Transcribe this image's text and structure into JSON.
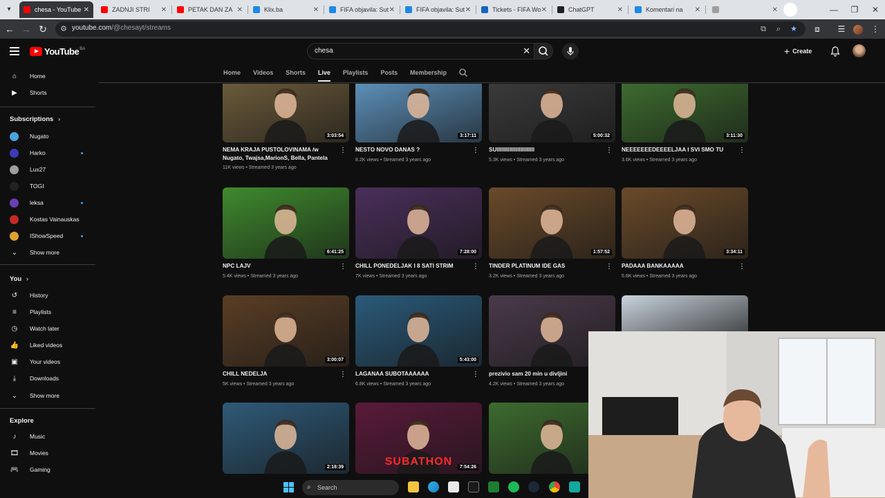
{
  "browser": {
    "tabs": [
      {
        "title": "chesa - YouTube",
        "active": true,
        "favicon_color": "#ff0000"
      },
      {
        "title": "ZADNJI STRI",
        "active": false,
        "favicon_color": "#ff0000"
      },
      {
        "title": "PETAK DAN ZA",
        "active": false,
        "favicon_color": "#ff0000"
      },
      {
        "title": "Klix.ba",
        "active": false,
        "favicon_color": "#1e88e5"
      },
      {
        "title": "FIFA objavila: Sut",
        "active": false,
        "favicon_color": "#1e88e5"
      },
      {
        "title": "FIFA objavila: Sut",
        "active": false,
        "favicon_color": "#1e88e5"
      },
      {
        "title": "Tickets - FIFA Wo",
        "active": false,
        "favicon_color": "#1565c0"
      },
      {
        "title": "ChatGPT",
        "active": false,
        "favicon_color": "#202124"
      },
      {
        "title": "Komentari na",
        "active": false,
        "favicon_color": "#1e88e5"
      },
      {
        "title": "",
        "active": false,
        "favicon_color": "#9e9e9e"
      }
    ],
    "url_host": "youtube.com",
    "url_path": "/@chesayt/streams"
  },
  "youtube": {
    "logo_text": "YouTube",
    "country_code": "BA",
    "search_value": "chesa",
    "create_label": "Create"
  },
  "channel_tabs": [
    {
      "label": "Home",
      "active": false
    },
    {
      "label": "Videos",
      "active": false
    },
    {
      "label": "Shorts",
      "active": false
    },
    {
      "label": "Live",
      "active": true
    },
    {
      "label": "Playlists",
      "active": false
    },
    {
      "label": "Posts",
      "active": false
    },
    {
      "label": "Membership",
      "active": false
    }
  ],
  "sidebar": {
    "main": [
      {
        "label": "Home",
        "icon": "home-icon"
      },
      {
        "label": "Shorts",
        "icon": "shorts-icon"
      }
    ],
    "subscriptions_heading": "Subscriptions",
    "subscriptions": [
      {
        "label": "Nugato",
        "color": "#4aa3df",
        "live": false
      },
      {
        "label": "Harko",
        "color": "#3b3bb8",
        "live": true
      },
      {
        "label": "Lux27",
        "color": "#9e9e9e",
        "live": false
      },
      {
        "label": "TOGI",
        "color": "#222222",
        "live": false
      },
      {
        "label": "leksa",
        "color": "#6a3fb5",
        "live": true
      },
      {
        "label": "Kostas Vainauskas",
        "color": "#c62828",
        "live": false
      },
      {
        "label": "IShowSpeed",
        "color": "#e0a030",
        "live": true
      }
    ],
    "subs_show_more": "Show more",
    "you_heading": "You",
    "you": [
      {
        "label": "History",
        "icon": "history-icon"
      },
      {
        "label": "Playlists",
        "icon": "playlists-icon"
      },
      {
        "label": "Watch later",
        "icon": "watch-later-icon"
      },
      {
        "label": "Liked videos",
        "icon": "like-icon"
      },
      {
        "label": "Your videos",
        "icon": "your-videos-icon"
      },
      {
        "label": "Downloads",
        "icon": "download-icon"
      }
    ],
    "you_show_more": "Show more",
    "explore_heading": "Explore",
    "explore": [
      {
        "label": "Music",
        "icon": "music-icon"
      },
      {
        "label": "Movies",
        "icon": "movies-icon"
      },
      {
        "label": "Gaming",
        "icon": "gaming-icon"
      }
    ]
  },
  "videos": [
    {
      "title": "NEMA KRAJA PUSTOLOVINAMA /w Nugato, Twajsa,MarionS, Bella, Pantela",
      "views": "11K views",
      "age": "Streamed 3 years ago",
      "duration": "3:03:54",
      "thumb": "#6b5a3a"
    },
    {
      "title": "NESTO NOVO DANAS ?",
      "views": "8.2K views",
      "age": "Streamed 3 years ago",
      "duration": "3:17:11",
      "thumb": "#5c8fb8"
    },
    {
      "title": "SUIIIIIIIIIIIIIIIIIIIIIIII",
      "views": "5.3K views",
      "age": "Streamed 3 years ago",
      "duration": "5:00:32",
      "thumb": "#3a3a3a"
    },
    {
      "title": "NEEEEEEEDEEEELJAA I SVI SMO TU",
      "views": "3.6K views",
      "age": "Streamed 3 years ago",
      "duration": "3:11:30",
      "thumb": "#3d6b2f"
    },
    {
      "title": "NPC LAJV",
      "views": "5.4K views",
      "age": "Streamed 3 years ago",
      "duration": "6:41:25",
      "thumb": "#3f8a2e"
    },
    {
      "title": "CHILL PONEDELJAK I 8 SATI STRIM",
      "views": "7K views",
      "age": "Streamed 3 years ago",
      "duration": "7:28:00",
      "thumb": "#4a2f5a"
    },
    {
      "title": "TINDER PLATINUM IDE GAS",
      "views": "3.2K views",
      "age": "Streamed 3 years ago",
      "duration": "1:57:52",
      "thumb": "#6a4a2a"
    },
    {
      "title": "PADAAA BANKAAAAA",
      "views": "5.6K views",
      "age": "Streamed 3 years ago",
      "duration": "3:34:11",
      "thumb": "#6a4a2a"
    },
    {
      "title": "CHILL NEDELJA",
      "views": "5K views",
      "age": "Streamed 3 years ago",
      "duration": "3:00:07",
      "thumb": "#5a3e25"
    },
    {
      "title": "LAGANAA SUBOTAAAAAA",
      "views": "6.8K views",
      "age": "Streamed 3 years ago",
      "duration": "5:43:00",
      "thumb": "#2b5a7a"
    },
    {
      "title": "prezivio sam 20 min u divljini",
      "views": "4.2K views",
      "age": "Streamed 3 years ago",
      "duration": "",
      "thumb": "#4a3a4a"
    },
    {
      "title": "",
      "views": "",
      "age": "",
      "duration": "",
      "thumb": "#c9d3dc"
    },
    {
      "title": "",
      "views": "",
      "age": "",
      "duration": "2:18:39",
      "thumb": "#2f5a78"
    },
    {
      "title": "",
      "views": "",
      "age": "",
      "duration": "7:54:26",
      "thumb": "#5a1a3a",
      "overlay_text": "SUBATHON"
    },
    {
      "title": "",
      "views": "",
      "age": "",
      "duration": "",
      "thumb": "#3d6b2f"
    }
  ],
  "taskbar": {
    "search_label": "Search"
  }
}
